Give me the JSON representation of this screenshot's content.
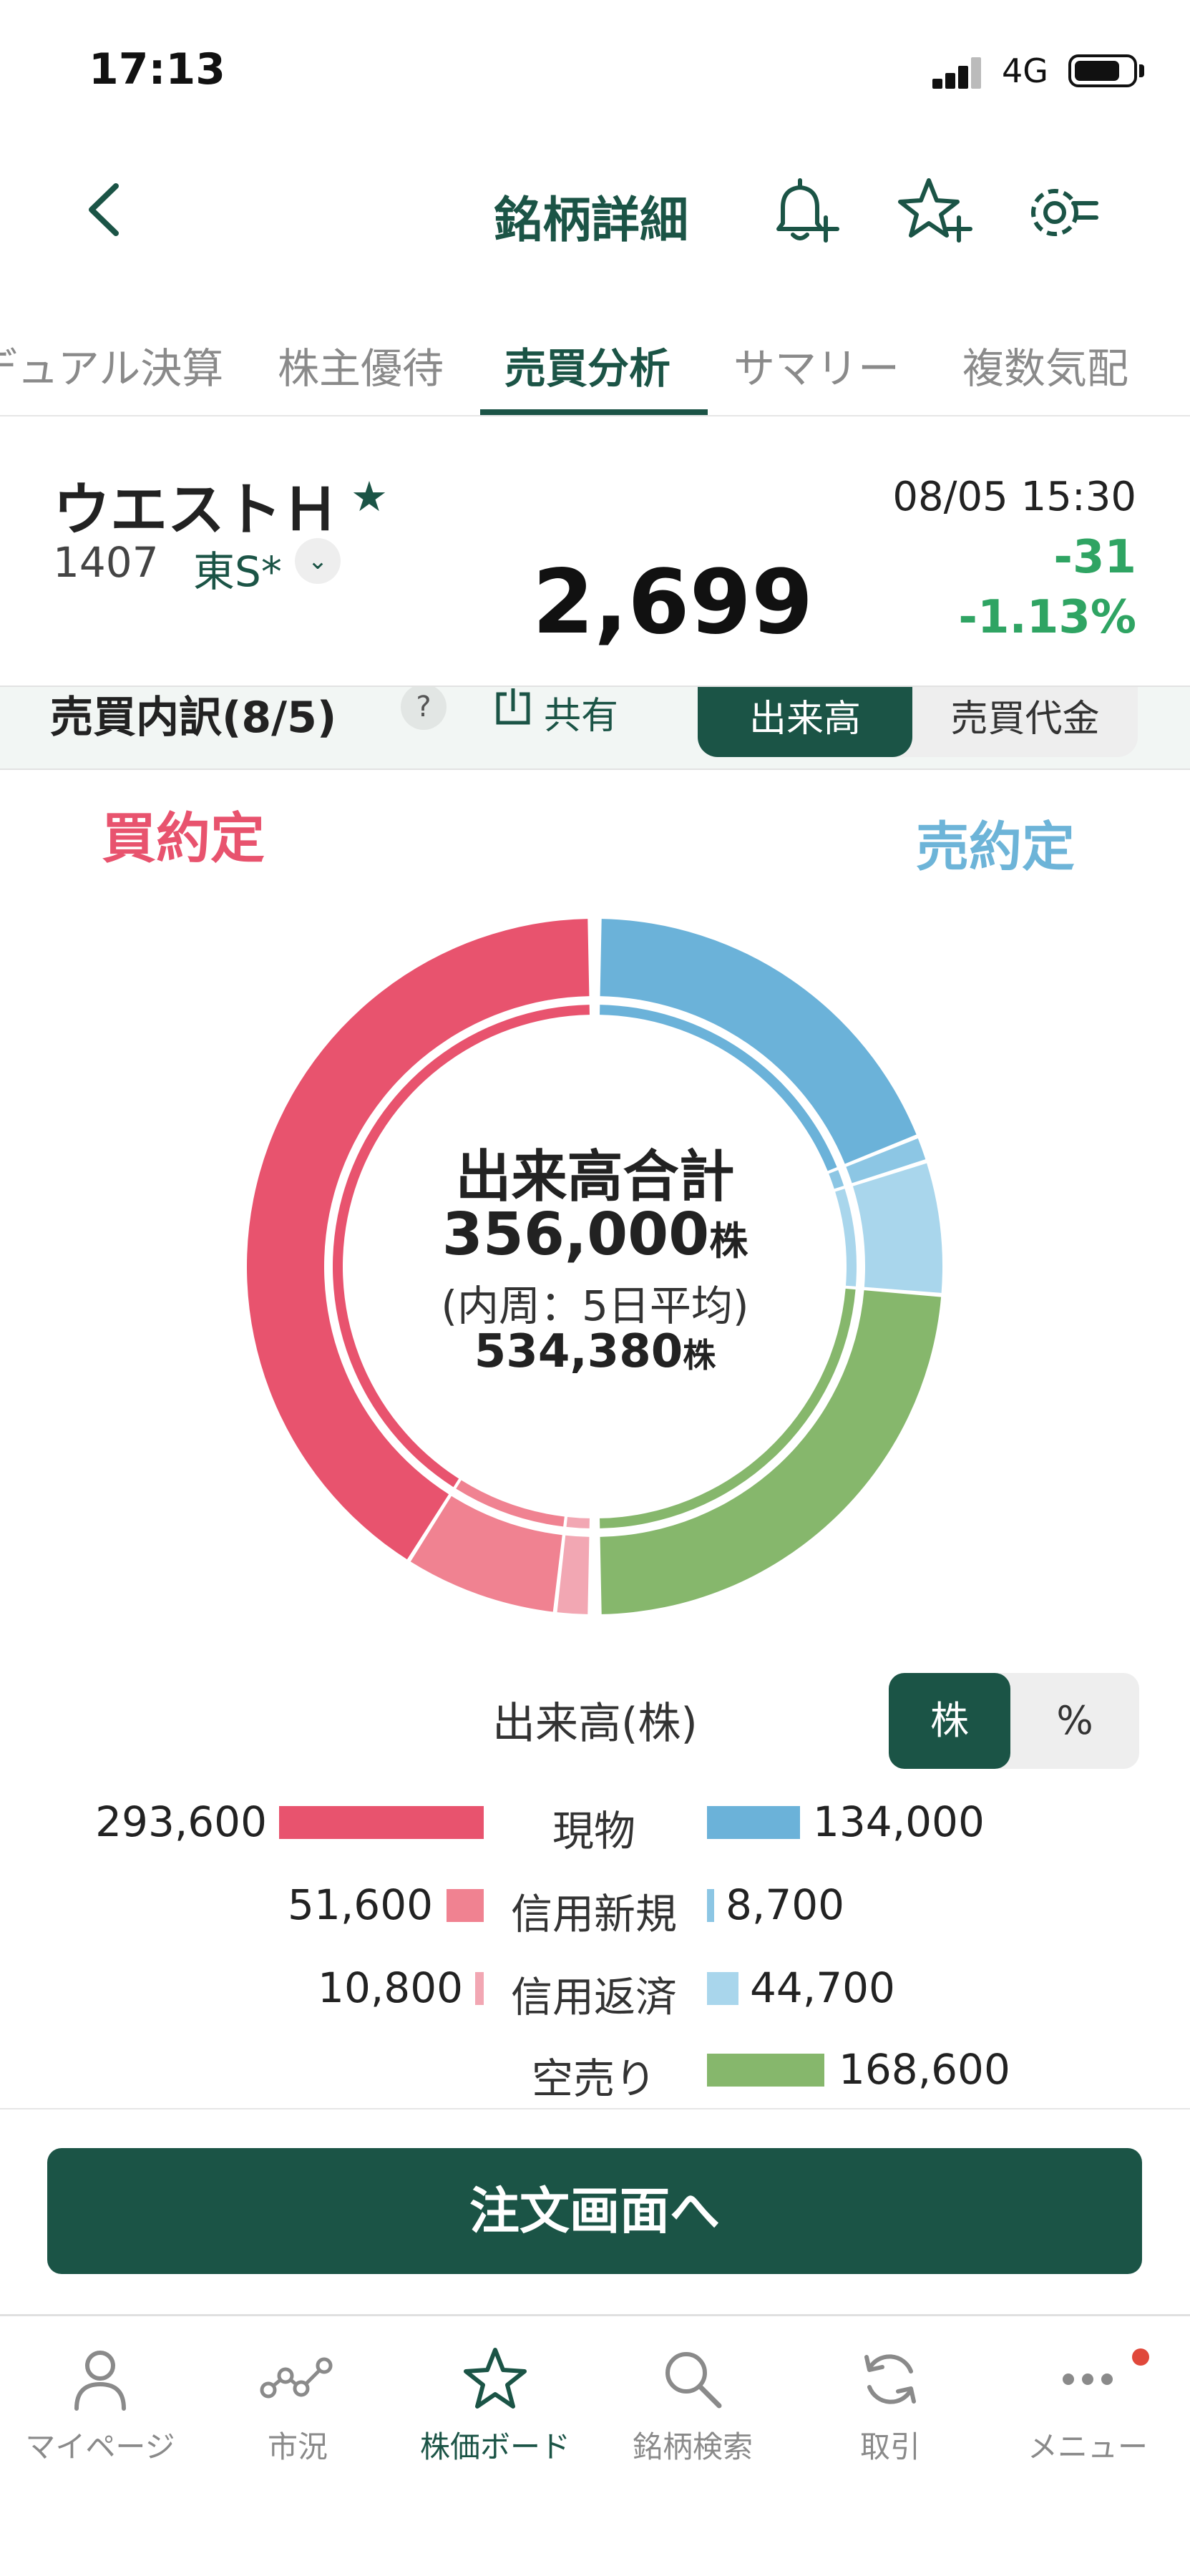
{
  "status_bar": {
    "time": "17:13",
    "network": "4G"
  },
  "header": {
    "title": "銘柄詳細"
  },
  "tabs": [
    {
      "label": "デュアル決算",
      "active": false
    },
    {
      "label": "株主優待",
      "active": false
    },
    {
      "label": "売買分析",
      "active": true
    },
    {
      "label": "サマリー",
      "active": false
    },
    {
      "label": "複数気配",
      "active": false
    }
  ],
  "stock": {
    "name": "ウエストＨ",
    "code": "1407",
    "market": "東S*",
    "price": "2,699",
    "datetime": "08/05 15:30",
    "change": "-31",
    "change_pct": "-1.13%"
  },
  "breakdown": {
    "title": "売買内訳(8/5)",
    "help": "?",
    "share_label": "共有",
    "toggle_volume": "出来高",
    "toggle_amount": "売買代金"
  },
  "chart_labels": {
    "buy": "買約定",
    "sell": "売約定"
  },
  "center": {
    "title": "出来高合計",
    "total": "356,000",
    "unit": "株",
    "sub": "(内周：5日平均)",
    "avg": "534,380"
  },
  "legend": {
    "title": "出来高(株)",
    "unit_shares": "株",
    "unit_pct": "%",
    "rows": [
      {
        "label": "現物",
        "buy": "293,600",
        "sell": "134,000"
      },
      {
        "label": "信用新規",
        "buy": "51,600",
        "sell": "8,700"
      },
      {
        "label": "信用返済",
        "buy": "10,800",
        "sell": "44,700"
      },
      {
        "label": "空売り",
        "buy": "",
        "sell": "168,600"
      }
    ]
  },
  "order_button": "注文画面へ",
  "nav": [
    {
      "label": "マイページ",
      "icon": "person-icon"
    },
    {
      "label": "市況",
      "icon": "market-icon"
    },
    {
      "label": "株価ボード",
      "icon": "star-icon",
      "active": true
    },
    {
      "label": "銘柄検索",
      "icon": "search-icon"
    },
    {
      "label": "取引",
      "icon": "refresh-icon"
    },
    {
      "label": "メニュー",
      "icon": "more-icon"
    }
  ],
  "colors": {
    "brand": "#1b5446",
    "buy_cash": "#e8536e",
    "buy_margin_new": "#f08291",
    "buy_margin_close": "#f2a7b3",
    "sell_cash": "#6bb2d9",
    "sell_margin_new": "#8cc6e4",
    "sell_margin_close": "#a9d6ec",
    "short_sell": "#86b76c",
    "positive": "#2fa463"
  },
  "chart_data": {
    "type": "pie",
    "title": "出来高合計",
    "outer": {
      "buy": [
        {
          "name": "現物",
          "value": 293600
        },
        {
          "name": "信用新規",
          "value": 51600
        },
        {
          "name": "信用返済",
          "value": 10800
        }
      ],
      "sell": [
        {
          "name": "現物",
          "value": 134000
        },
        {
          "name": "信用新規",
          "value": 8700
        },
        {
          "name": "信用返済",
          "value": 44700
        },
        {
          "name": "空売り",
          "value": 168600
        }
      ]
    },
    "inner_5day_avg_total": 534380
  }
}
